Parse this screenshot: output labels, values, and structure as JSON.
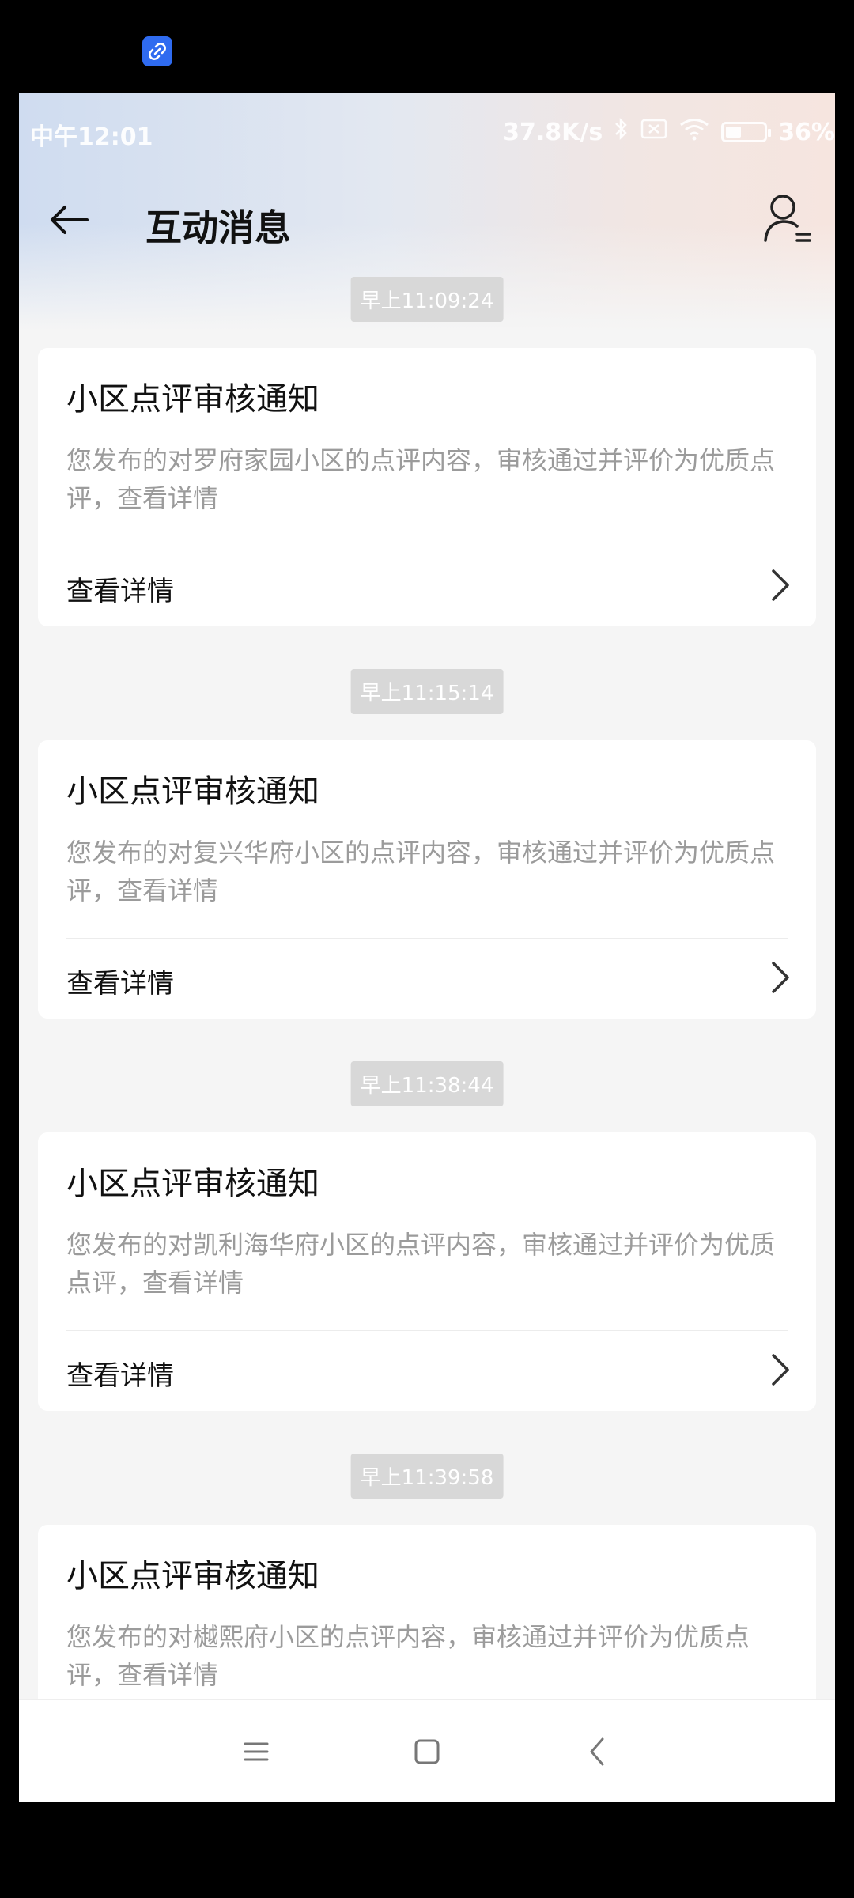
{
  "status_bar": {
    "time": "中午12:01",
    "net_speed": "37.8K/s",
    "battery": "36%"
  },
  "header": {
    "title": "互动消息"
  },
  "messages": [
    {
      "timestamp": "早上11:09:24",
      "title": "小区点评审核通知",
      "body": "您发布的对罗府家园小区的点评内容，审核通过并评价为优质点评，查看详情",
      "action": "查看详情"
    },
    {
      "timestamp": "早上11:15:14",
      "title": "小区点评审核通知",
      "body": "您发布的对复兴华府小区的点评内容，审核通过并评价为优质点评，查看详情",
      "action": "查看详情"
    },
    {
      "timestamp": "早上11:38:44",
      "title": "小区点评审核通知",
      "body": "您发布的对凯利海华府小区的点评内容，审核通过并评价为优质点评，查看详情",
      "action": "查看详情"
    },
    {
      "timestamp": "早上11:39:58",
      "title": "小区点评审核通知",
      "body": "您发布的对樾熙府小区的点评内容，审核通过并评价为优质点评，查看详情"
    }
  ],
  "icons": {
    "top_badge": "link-icon",
    "back": "arrow-left-icon",
    "user": "user-menu-icon",
    "chevron": "chevron-right-icon",
    "nav_menu": "menu-icon",
    "nav_home": "home-square-icon",
    "nav_back": "back-chevron-icon"
  },
  "colors": {
    "accent_badge": "#2f6bf0",
    "timestamp_bg": "#d8d8d8",
    "body_text": "#9b9b9b"
  }
}
